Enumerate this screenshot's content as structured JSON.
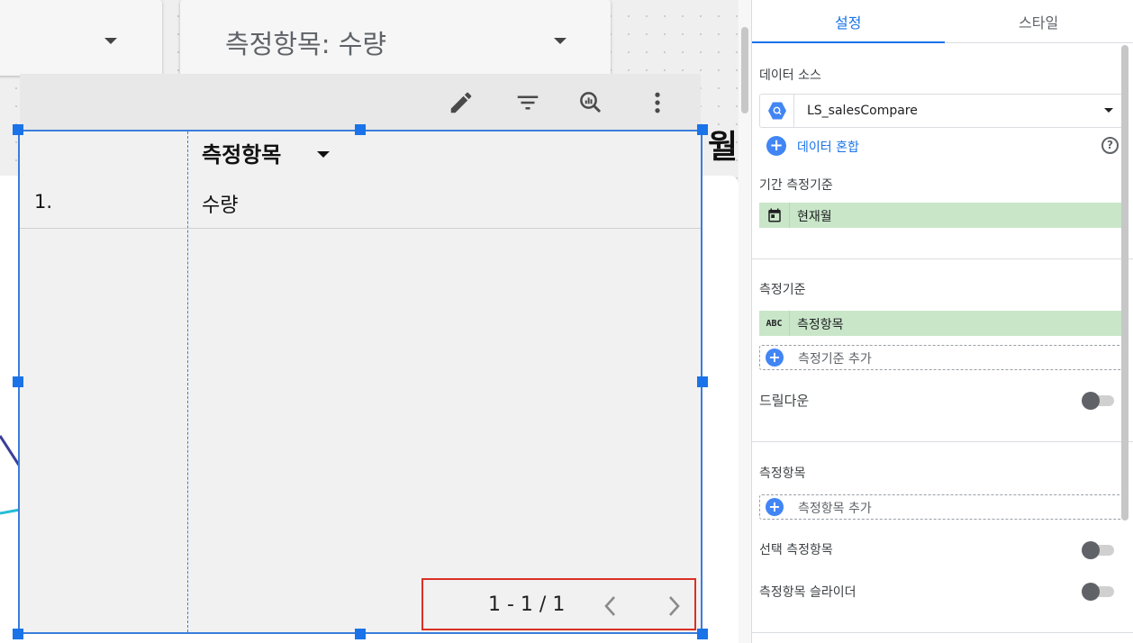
{
  "canvas": {
    "filter1": {
      "label": ""
    },
    "filter2": {
      "label": "측정항목: 수량"
    },
    "toolbar": {
      "icons": [
        "edit-icon",
        "filter-icon",
        "explore-icon",
        "more-vert-icon"
      ]
    },
    "table": {
      "header": "측정항목",
      "rows": [
        {
          "index": "1.",
          "value": "수량"
        }
      ],
      "pagination": "1 - 1 / 1"
    },
    "side_text": "월"
  },
  "panel": {
    "tabs": {
      "setup": "설정",
      "style": "스타일"
    },
    "data_source": {
      "label": "데이터 소스",
      "name": "LS_salesCompare",
      "blend_label": "데이터 혼합",
      "help": "?"
    },
    "date_range": {
      "label": "기간 측정기준",
      "value": "현재월"
    },
    "dimension": {
      "label": "측정기준",
      "chip_type": "ABC",
      "value": "측정항목",
      "add_label": "측정기준 추가",
      "drilldown_label": "드릴다운",
      "drilldown_on": false
    },
    "metric": {
      "label": "측정항목",
      "add_label": "측정항목 추가",
      "optional_label": "선택 측정항목",
      "optional_on": false,
      "slider_label": "측정항목 슬라이더",
      "slider_on": false
    }
  },
  "colors": {
    "accent": "#1a73e8",
    "chip_bg": "#c9e6c9",
    "selection": "#3b7ddd",
    "highlight_border": "#d93025"
  }
}
